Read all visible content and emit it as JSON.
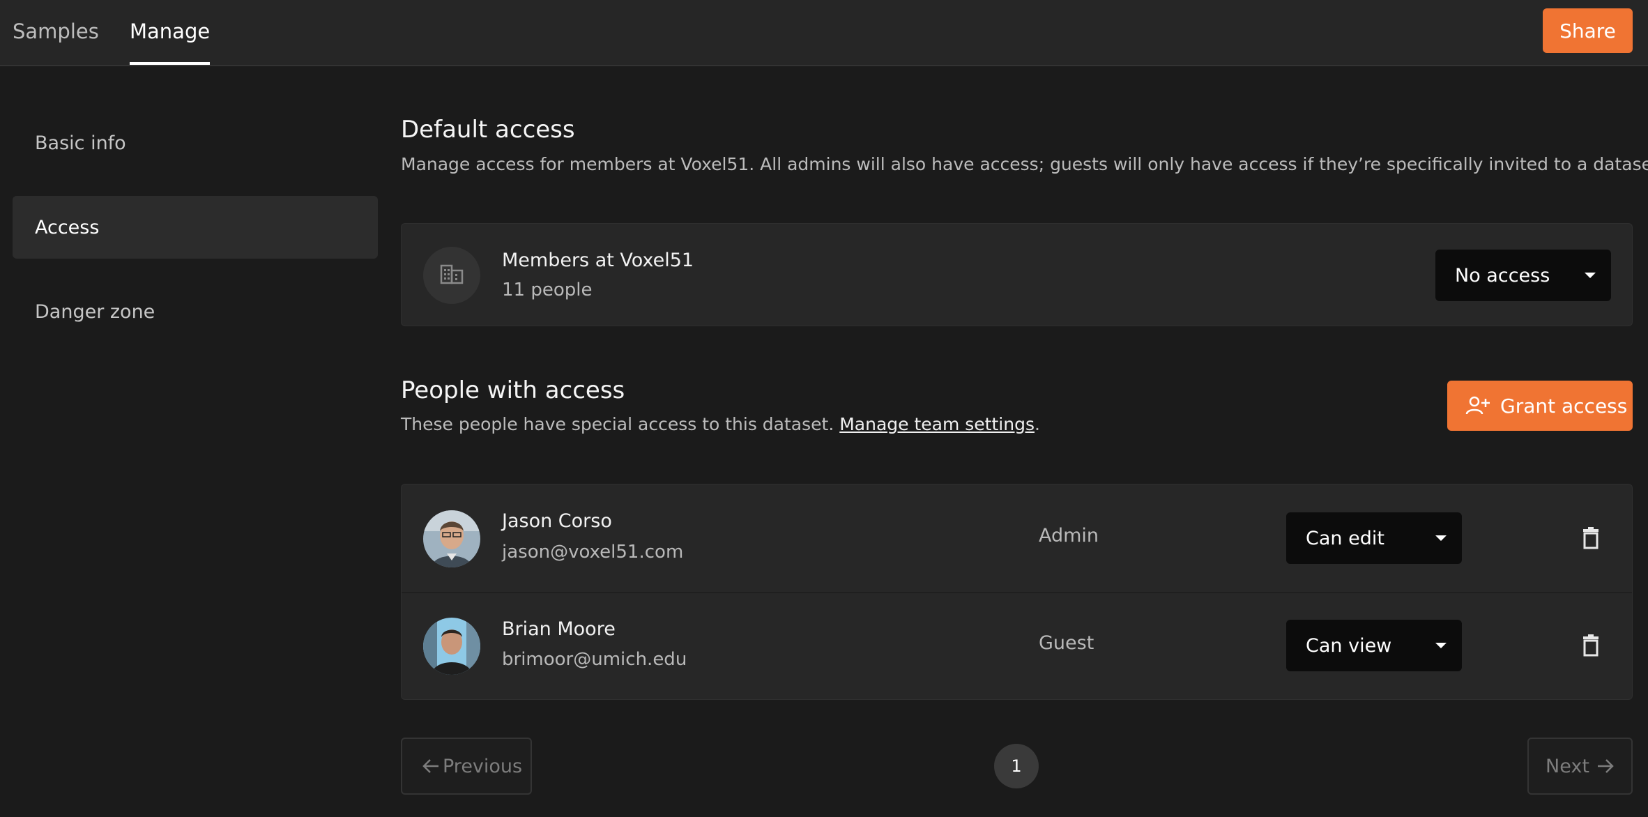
{
  "topbar": {
    "tabs": [
      {
        "label": "Samples"
      },
      {
        "label": "Manage"
      }
    ],
    "share_label": "Share"
  },
  "sidebar": {
    "items": [
      {
        "label": "Basic info"
      },
      {
        "label": "Access"
      },
      {
        "label": "Danger zone"
      }
    ]
  },
  "default_access": {
    "title": "Default access",
    "description": "Manage access for members at Voxel51. All admins will also have access; guests will only have access if they’re specifically invited to a dataset.",
    "members": {
      "name": "Members at Voxel51",
      "count": "11 people",
      "icon": "building-icon",
      "access": "No access"
    }
  },
  "people_access": {
    "title": "People with access",
    "description_prefix": "These people have special access to this dataset.",
    "link": "Manage team settings",
    "description_suffix": ".",
    "grant_label": "Grant access",
    "people": [
      {
        "name": "Jason Corso",
        "email": "jason@voxel51.com",
        "role": "Admin",
        "permission": "Can edit"
      },
      {
        "name": "Brian Moore",
        "email": "brimoor@umich.edu",
        "role": "Guest",
        "permission": "Can view"
      }
    ]
  },
  "pagination": {
    "previous": "Previous",
    "page": "1",
    "next": "Next"
  },
  "colors": {
    "accent": "#f07433",
    "background": "#1b1b1b",
    "card": "#272727"
  }
}
